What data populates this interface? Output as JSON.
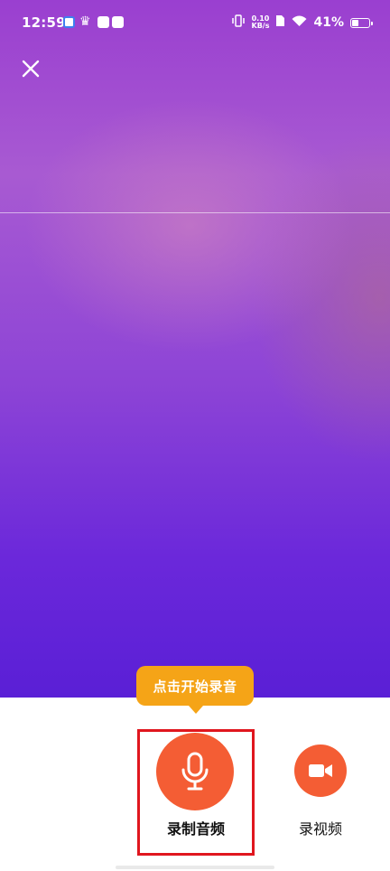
{
  "status_bar": {
    "time": "12:59",
    "net_speed_value": "0.10",
    "net_speed_unit": "KB/s",
    "battery_percent": "41%",
    "battery_level": 0.41
  },
  "tooltip": {
    "text": "点击开始录音"
  },
  "actions": {
    "record_audio_label": "录制音频",
    "record_video_label": "录视频"
  },
  "colors": {
    "accent": "#f45d34",
    "tooltip": "#f5a417",
    "highlight": "#e0161e"
  },
  "icons": {
    "close": "close-icon",
    "microphone": "microphone-icon",
    "video_camera": "video-camera-icon"
  }
}
